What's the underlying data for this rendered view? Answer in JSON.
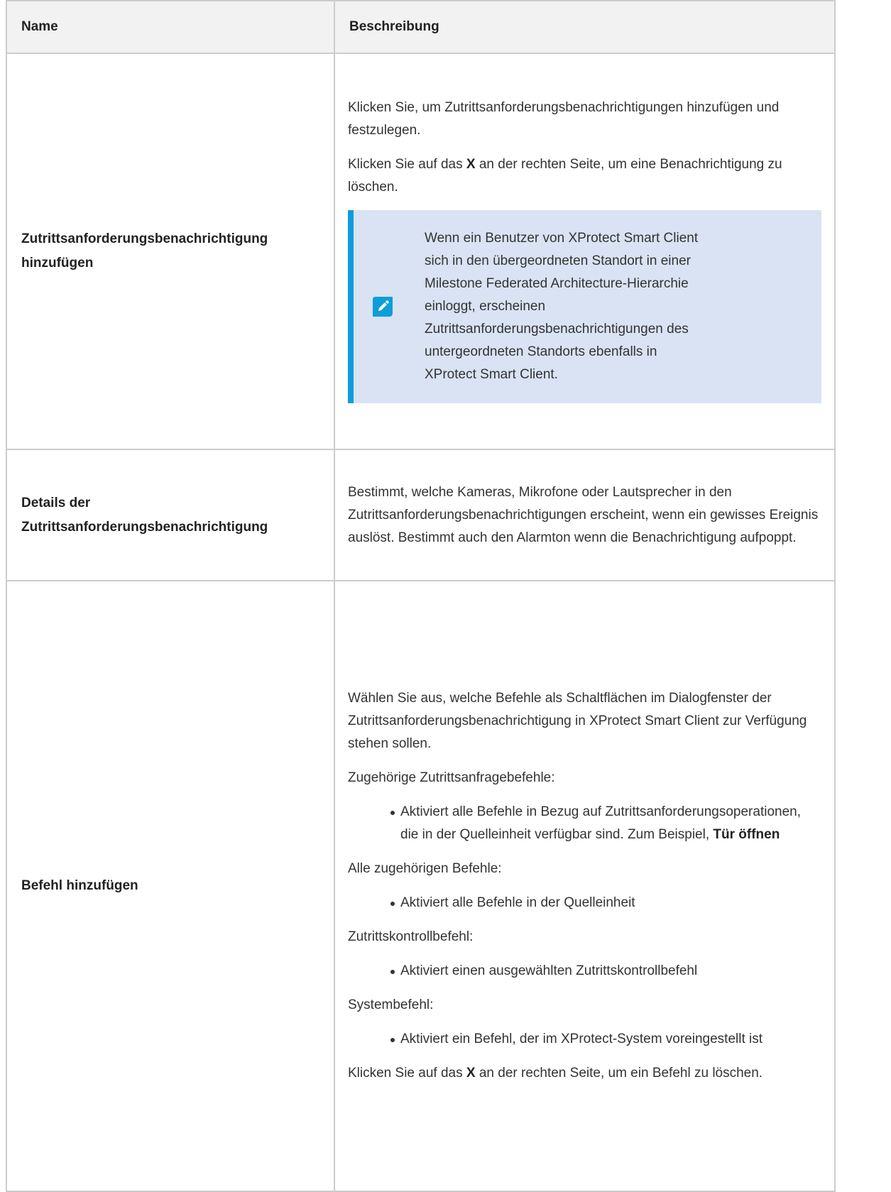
{
  "table": {
    "headers": {
      "name": "Name",
      "description": "Beschreibung"
    },
    "row1": {
      "name": "Zutrittsanforderungsbenachrichtigung hinzufügen",
      "p1": "Klicken Sie, um Zutrittsanforderungsbenachrichtigungen hinzufügen und festzulegen.",
      "p2_before": "Klicken Sie auf das ",
      "p2_bold": "X",
      "p2_after": " an der rechten Seite, um eine Benachrichtigung zu löschen.",
      "note": "Wenn ein Benutzer von XProtect Smart Client sich in den übergeordneten Standort in einer Milestone Federated Architecture-Hierarchie einloggt, erscheinen Zutrittsanforderungsbenachrichtigungen des untergeordneten Standorts ebenfalls in XProtect Smart Client."
    },
    "row2": {
      "name": "Details der Zutrittsanforderungsbenachrichtigung",
      "p1": "Bestimmt, welche Kameras, Mikrofone oder Lautsprecher in den Zutrittsanforderungsbenachrichtigungen erscheint, wenn ein gewisses Ereignis auslöst. Bestimmt auch den Alarmton wenn die Benachrichtigung aufpoppt."
    },
    "row3": {
      "name": "Befehl hinzufügen",
      "intro": "Wählen Sie aus, welche Befehle als Schaltflächen im Dialogfenster der Zutrittsanforderungsbenachrichtigung in XProtect Smart Client zur Verfügung stehen sollen.",
      "g1_label": "Zugehörige Zutrittsanfragebefehle:",
      "g1_bullet_text": "Aktiviert alle Befehle in Bezug auf Zutrittsanforderungsoperationen, die in der Quelleinheit verfügbar sind. Zum Beispiel, ",
      "g1_bullet_bold": "Tür öffnen",
      "g2_label": "Alle zugehörigen Befehle:",
      "g2_bullet": "Aktiviert alle Befehle in der Quelleinheit",
      "g3_label": "Zutrittskontrollbefehl:",
      "g3_bullet": "Aktiviert einen ausgewählten Zutrittskontrollbefehl",
      "g4_label": "Systembefehl:",
      "g4_bullet": "Aktiviert ein Befehl, der im XProtect-System voreingestellt ist",
      "end_before": "Klicken Sie auf das ",
      "end_bold": "X",
      "end_after": " an der rechten Seite, um ein Befehl zu löschen."
    }
  },
  "colors": {
    "note_background": "#d9e3f3",
    "note_accent": "#0d9ddb",
    "header_background": "#f2f2f2",
    "border": "#cccccc"
  },
  "icons": {
    "note": "pencil-note-icon"
  }
}
